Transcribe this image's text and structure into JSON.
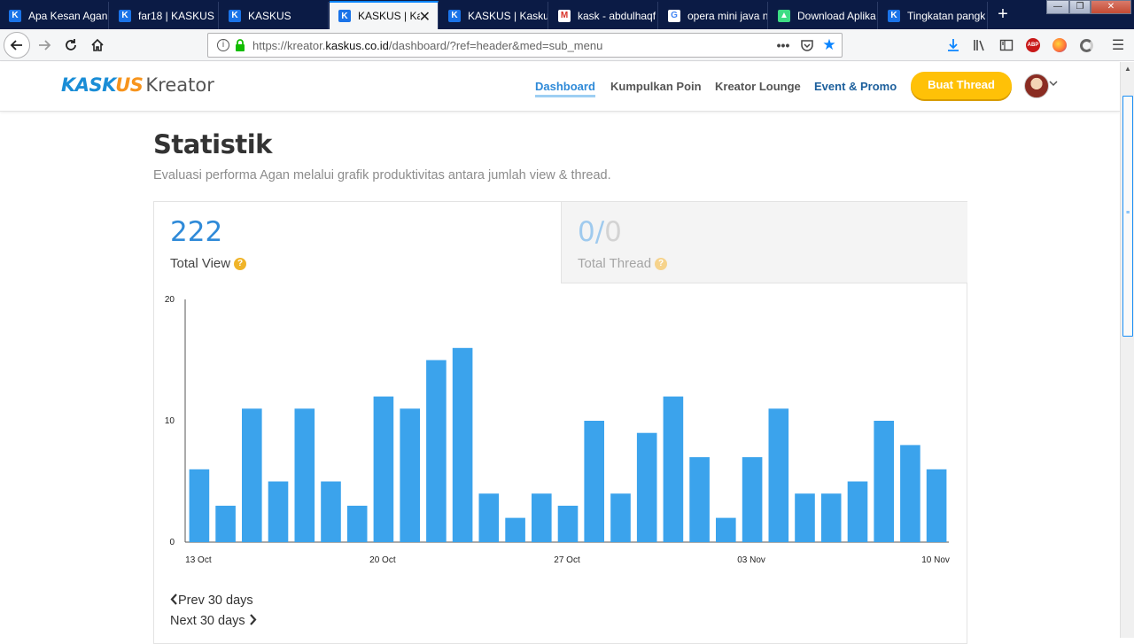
{
  "browser": {
    "tabs": [
      {
        "label": "Apa Kesan Agan",
        "icon": "kaskus-icon",
        "active": false
      },
      {
        "label": "far18 | KASKUS",
        "icon": "kaskus-icon",
        "active": false
      },
      {
        "label": "KASKUS",
        "icon": "kaskus-icon",
        "active": false
      },
      {
        "label": "KASKUS | Kas",
        "icon": "kaskus-icon",
        "active": true
      },
      {
        "label": "KASKUS | Kaskus",
        "icon": "kaskus-icon",
        "active": false
      },
      {
        "label": "kask - abdulhaqf",
        "icon": "gmail-icon",
        "active": false
      },
      {
        "label": "opera mini java n",
        "icon": "google-icon",
        "active": false
      },
      {
        "label": "Download Aplika",
        "icon": "apk-icon",
        "active": false
      },
      {
        "label": "Tingkatan pangk",
        "icon": "kaskus-icon",
        "active": false
      }
    ],
    "url_prefix": "https://kreator.",
    "url_domain": "kaskus.co.id",
    "url_path": "/dashboard/?ref=header&med=sub_menu",
    "abp_label": "ABP"
  },
  "header": {
    "logo_kaskus_a": "KASK",
    "logo_kaskus_b": "US",
    "logo_kreator": "Kreator",
    "nav": {
      "dashboard": "Dashboard",
      "kumpulkan_poin": "Kumpulkan Poin",
      "kreator_lounge": "Kreator Lounge",
      "event_promo": "Event & Promo"
    },
    "buat_thread": "Buat Thread"
  },
  "main": {
    "title": "Statistik",
    "subtitle": "Evaluasi performa Agan melalui grafik produktivitas antara jumlah view & thread.",
    "stats": {
      "total_view_value": "222",
      "total_view_label": "Total View",
      "total_thread_done": "0/",
      "total_thread_target": "0",
      "total_thread_label": "Total Thread",
      "help_symbol": "?"
    },
    "pager": {
      "prev": "Prev 30 days",
      "next": "Next 30 days"
    }
  },
  "colors": {
    "accent": "#2f8ad8",
    "bar": "#3ba3ec",
    "button": "#ffc107"
  },
  "chart_data": {
    "type": "bar",
    "ylim": [
      0,
      20
    ],
    "yticks": [
      0,
      10,
      20
    ],
    "x_tick_labels": [
      "13 Oct",
      "20 Oct",
      "27 Oct",
      "03 Nov",
      "10 Nov"
    ],
    "x_tick_positions": [
      0,
      7,
      14,
      21,
      28
    ],
    "categories": [
      "13 Oct",
      "14 Oct",
      "15 Oct",
      "16 Oct",
      "17 Oct",
      "18 Oct",
      "19 Oct",
      "20 Oct",
      "21 Oct",
      "22 Oct",
      "23 Oct",
      "24 Oct",
      "25 Oct",
      "26 Oct",
      "27 Oct",
      "28 Oct",
      "29 Oct",
      "30 Oct",
      "31 Oct",
      "01 Nov",
      "02 Nov",
      "03 Nov",
      "04 Nov",
      "05 Nov",
      "06 Nov",
      "07 Nov",
      "08 Nov",
      "09 Nov",
      "10 Nov"
    ],
    "values": [
      6,
      3,
      11,
      5,
      11,
      5,
      3,
      12,
      11,
      15,
      16,
      4,
      2,
      4,
      3,
      10,
      4,
      9,
      12,
      7,
      2,
      7,
      11,
      4,
      4,
      5,
      10,
      8,
      6
    ]
  }
}
